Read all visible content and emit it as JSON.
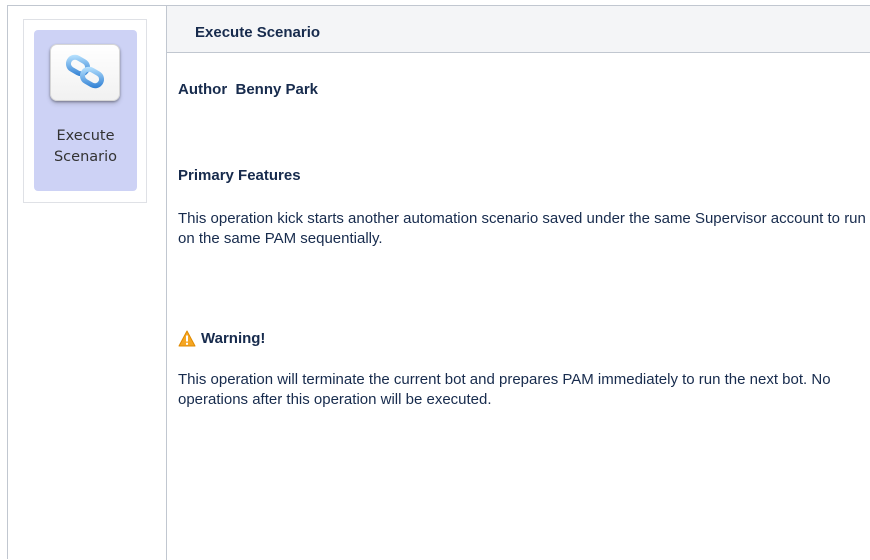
{
  "tile": {
    "label": "Execute\nScenario",
    "icon": "chain-link-icon"
  },
  "header": {
    "title": "Execute Scenario"
  },
  "content": {
    "author_line": "Author  Benny Park",
    "features_title": "Primary Features",
    "features_text": "This operation kick starts another automation scenario saved under the same Supervisor account to run on the same PAM sequentially.",
    "warning_title": "Warning!",
    "warning_text": "This operation will terminate the current bot and prepares PAM immediately to run the next bot. No operations after this operation will be executed."
  },
  "colors": {
    "tile_bg": "#cdd2f5",
    "header_bg": "#f4f5f7",
    "warning_icon": "#f5a623"
  }
}
